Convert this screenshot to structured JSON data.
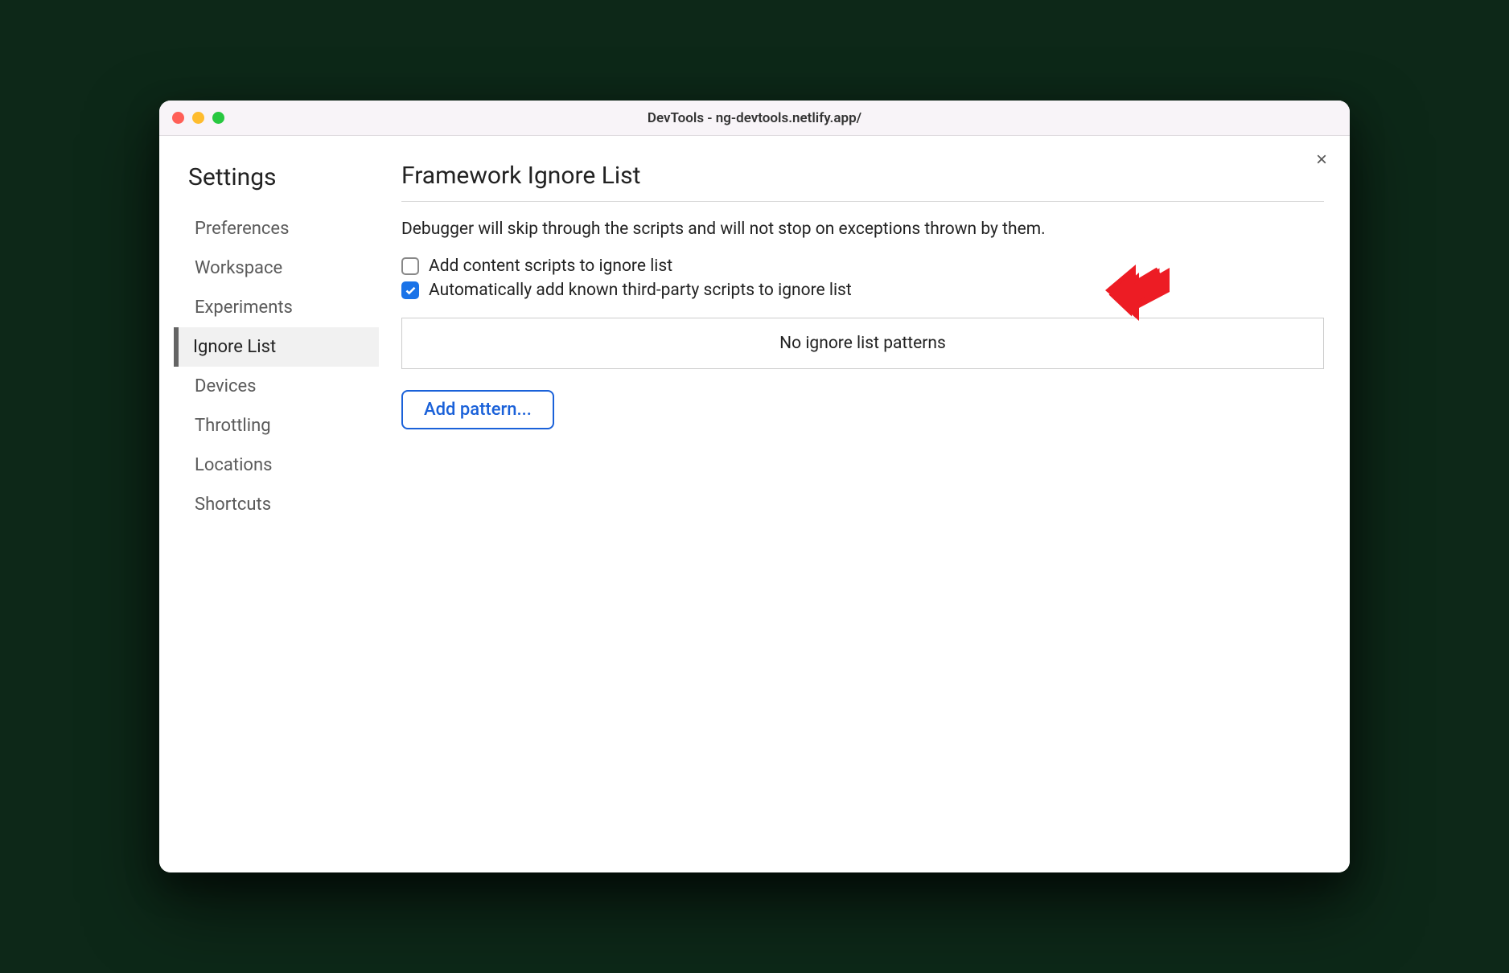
{
  "window": {
    "title": "DevTools - ng-devtools.netlify.app/"
  },
  "sidebar": {
    "title": "Settings",
    "items": [
      {
        "label": "Preferences",
        "active": false
      },
      {
        "label": "Workspace",
        "active": false
      },
      {
        "label": "Experiments",
        "active": false
      },
      {
        "label": "Ignore List",
        "active": true
      },
      {
        "label": "Devices",
        "active": false
      },
      {
        "label": "Throttling",
        "active": false
      },
      {
        "label": "Locations",
        "active": false
      },
      {
        "label": "Shortcuts",
        "active": false
      }
    ]
  },
  "main": {
    "title": "Framework Ignore List",
    "description": "Debugger will skip through the scripts and will not stop on exceptions thrown by them.",
    "checkboxes": [
      {
        "label": "Add content scripts to ignore list",
        "checked": false
      },
      {
        "label": "Automatically add known third-party scripts to ignore list",
        "checked": true
      }
    ],
    "patterns_empty": "No ignore list patterns",
    "add_button": "Add pattern..."
  },
  "close_label": "×"
}
